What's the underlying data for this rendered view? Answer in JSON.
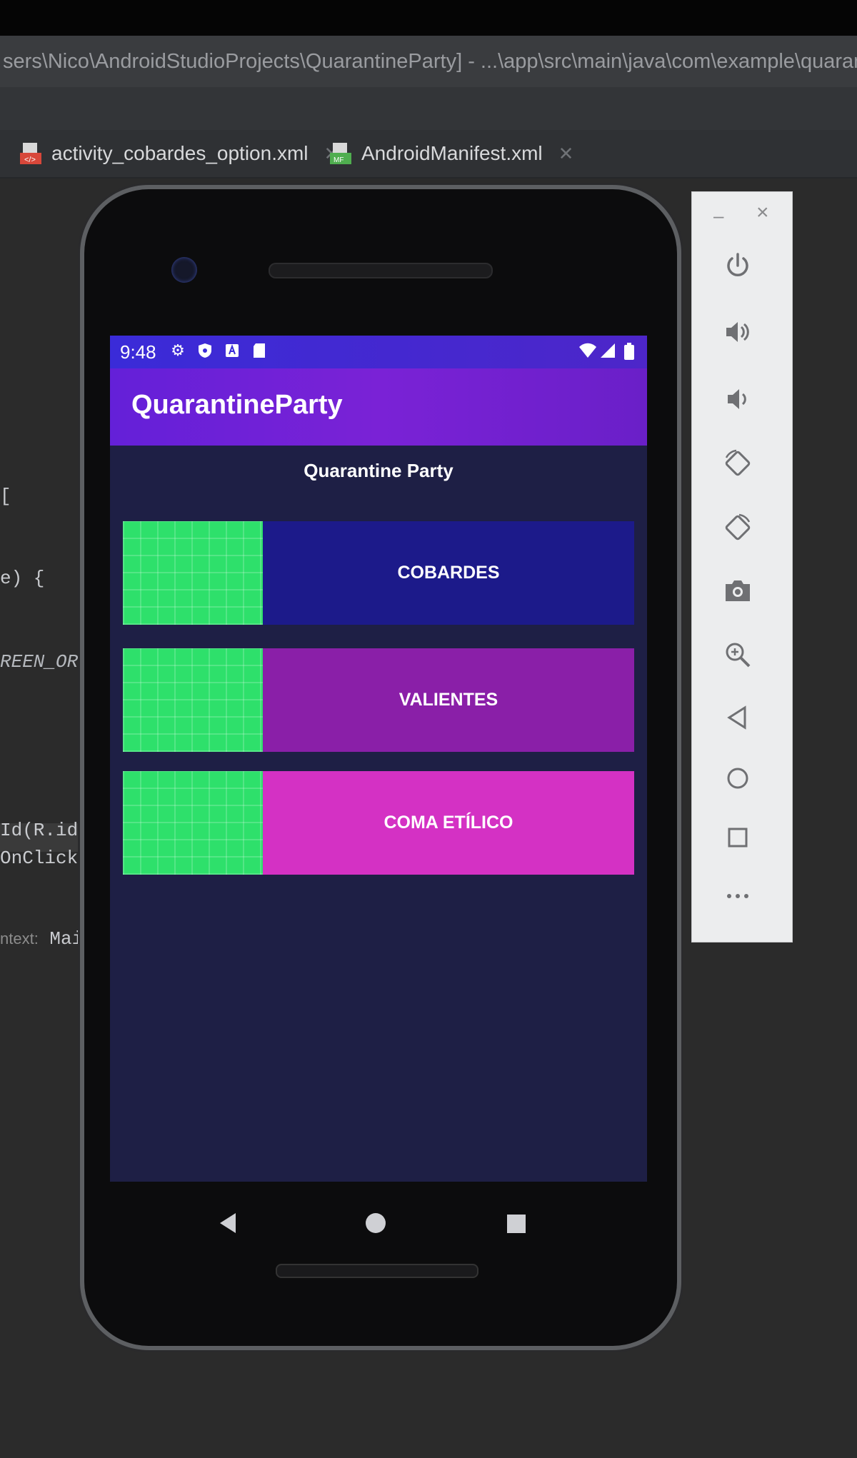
{
  "window": {
    "title": "sers\\Nico\\AndroidStudioProjects\\QuarantineParty] - ...\\app\\src\\main\\java\\com\\example\\quarantineparty"
  },
  "tabs": [
    {
      "label": "activity_cobardes_option.xml",
      "icon": "xml-file-icon"
    },
    {
      "label": "AndroidManifest.xml",
      "icon": "manifest-file-icon"
    }
  ],
  "code_lines": [
    {
      "text": "["
    },
    {
      "text": "e) {"
    },
    {
      "text": "REEN_ORIEN"
    },
    {
      "text": "Id(R.id.",
      "italic": "col"
    },
    {
      "text": "OnClickList"
    },
    {
      "hint": "ntext:",
      "text": "MainAc"
    }
  ],
  "device": {
    "status_bar": {
      "time": "9:48"
    },
    "app_bar": {
      "title": "QuarantineParty"
    },
    "heading": "Quarantine Party",
    "options": [
      {
        "label": "COBARDES",
        "color": "#1c1a8a"
      },
      {
        "label": "VALIENTES",
        "color": "#8a1fa8"
      },
      {
        "label": "COMA ETÍLICO",
        "color": "#d431c4"
      }
    ]
  },
  "emulator_toolbar": {
    "buttons": [
      "power-icon",
      "volume-up-icon",
      "volume-down-icon",
      "rotate-left-icon",
      "rotate-right-icon",
      "camera-icon",
      "zoom-icon",
      "back-icon",
      "home-icon",
      "overview-icon",
      "more-icon"
    ]
  }
}
